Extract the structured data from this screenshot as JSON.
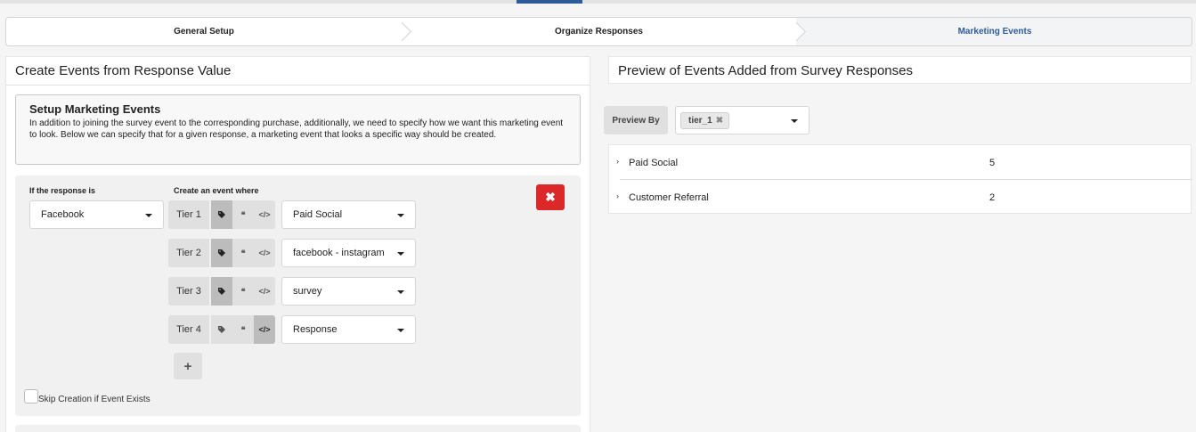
{
  "steps": [
    {
      "label": "General Setup"
    },
    {
      "label": "Organize Responses"
    },
    {
      "label": "Marketing Events"
    }
  ],
  "left": {
    "title": "Create Events from Response Value",
    "setup": {
      "title": "Setup Marketing Events",
      "description": "In addition to joining the survey event to the corresponding purchase, additionally, we need to specify how we want this marketing event to look. Below we can specify that for a given response, a marketing event that looks a specific way should be created."
    },
    "rule": {
      "response_label": "If the response is",
      "event_label": "Create an event where",
      "response_value": "Facebook",
      "tiers": [
        {
          "label": "Tier 1",
          "value": "Paid Social",
          "active": "tag"
        },
        {
          "label": "Tier 2",
          "value": "facebook - instagram",
          "active": "tag"
        },
        {
          "label": "Tier 3",
          "value": "survey",
          "active": "tag"
        },
        {
          "label": "Tier 4",
          "value": "Response",
          "active": "code"
        }
      ],
      "icons": {
        "tag": "tag-icon",
        "quote": "quote-icon",
        "code": "code-icon"
      },
      "delete_icon": "close-icon",
      "add_icon": "plus-icon",
      "skip_label": "Skip Creation if Event Exists",
      "skip_checked": false
    }
  },
  "right": {
    "title": "Preview of Events Added from Survey Responses",
    "preview_by_label": "Preview By",
    "preview_chip": "tier_1",
    "rows": [
      {
        "name": "Paid Social",
        "count": "5"
      },
      {
        "name": "Customer Referral",
        "count": "2"
      }
    ]
  },
  "colors": {
    "accent": "#2d5c99",
    "danger": "#db2828"
  }
}
